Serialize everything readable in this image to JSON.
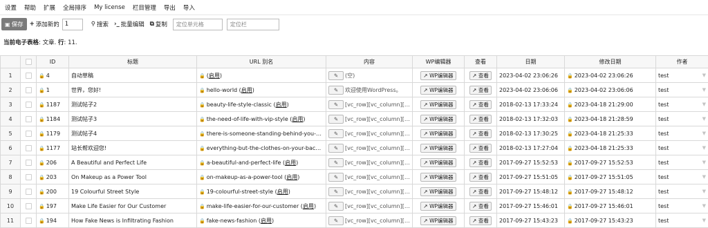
{
  "menu": {
    "items": [
      "设置",
      "帮助",
      "扩展",
      "全局排序",
      "My license",
      "栏目管理",
      "导出",
      "导入"
    ]
  },
  "toolbar": {
    "save_label": "保存",
    "add_new_label": "添加新的",
    "add_new_count": "1",
    "search_label": "搜索",
    "bulk_edit_label": "批量编辑",
    "copy_label": "复制",
    "locate_cell_placeholder": "定位单元格",
    "locate_column_placeholder": "定位栏"
  },
  "current_sheet": {
    "prefix": "当前电子表格",
    "sheet": "文章",
    "rows_label": "行",
    "rows_value": "11."
  },
  "table": {
    "headers": [
      "ID",
      "标题",
      "URL 别名",
      "内容",
      "WP编辑器",
      "查看",
      "日期",
      "修改日期",
      "作者"
    ],
    "edit_button_label": "",
    "wp_editor_label": "WP编辑器",
    "view_label": "查看",
    "enable_label": "启用",
    "rows": [
      {
        "num": "1",
        "id": "4",
        "title": "自动草稿",
        "slug": "",
        "content": "(空)",
        "date": "2023-04-02 23:06:26",
        "modified": "2023-04-02 23:06:26",
        "author": "test"
      },
      {
        "num": "2",
        "id": "1",
        "title": "世界，您好!",
        "slug": "hello-world",
        "content": "欢迎使用WordPress。",
        "date": "2023-04-02 23:06:06",
        "modified": "2023-04-02 23:06:06",
        "author": "test"
      },
      {
        "num": "3",
        "id": "1187",
        "title": "测试帖子2",
        "slug": "beauty-life-style-classic",
        "content": "[vc_row][vc_column][vc_",
        "date": "2018-02-13 17:33:24",
        "modified": "2023-04-18 21:29:00",
        "author": "test"
      },
      {
        "num": "4",
        "id": "1184",
        "title": "测试帖子3",
        "slug": "the-need-of-life-with-vip-style",
        "content": "[vc_row][vc_column][vc_",
        "date": "2018-02-13 17:32:03",
        "modified": "2023-04-18 21:28:59",
        "author": "test"
      },
      {
        "num": "5",
        "id": "1179",
        "title": "测试帖子4",
        "slug": "there-is-someone-standing-behind-you-(...",
        "content": "[vc_row][vc_column][vc_",
        "date": "2018-02-13 17:30:25",
        "modified": "2023-04-18 21:25:33",
        "author": "test"
      },
      {
        "num": "6",
        "id": "1177",
        "title": "站长帮欢迎您!",
        "slug": "everything-but-the-clothes-on-your-back (...",
        "content": "[vc_row][vc_column][vc_",
        "date": "2018-02-13 17:27:04",
        "modified": "2023-04-18 21:25:33",
        "author": "test"
      },
      {
        "num": "7",
        "id": "206",
        "title": "A Beautiful and Perfect Life",
        "slug": "a-beautiful-and-perfect-life",
        "content": "[vc_row][vc_column][vc_",
        "date": "2017-09-27 15:52:53",
        "modified": "2017-09-27 15:52:53",
        "author": "test"
      },
      {
        "num": "8",
        "id": "203",
        "title": "On Makeup as a Power Tool",
        "slug": "on-makeup-as-a-power-tool",
        "content": "[vc_row][vc_column][vc_",
        "date": "2017-09-27 15:51:05",
        "modified": "2017-09-27 15:51:05",
        "author": "test"
      },
      {
        "num": "9",
        "id": "200",
        "title": "19 Colourful Street Style",
        "slug": "19-colourful-street-style",
        "content": "[vc_row][vc_column][vc_",
        "date": "2017-09-27 15:48:12",
        "modified": "2017-09-27 15:48:12",
        "author": "test"
      },
      {
        "num": "10",
        "id": "197",
        "title": "Make Life Easier for Our Customer",
        "slug": "make-life-easier-for-our-customer",
        "content": "[vc_row][vc_column][vc_",
        "date": "2017-09-27 15:46:01",
        "modified": "2017-09-27 15:46:01",
        "author": "test"
      },
      {
        "num": "11",
        "id": "194",
        "title": "How Fake News is Infiltrating Fashion",
        "slug": "fake-news-fashion",
        "content": "[vc_row][vc_column][vc_",
        "date": "2017-09-27 15:43:23",
        "modified": "2017-09-27 15:43:23",
        "author": "test"
      }
    ]
  }
}
